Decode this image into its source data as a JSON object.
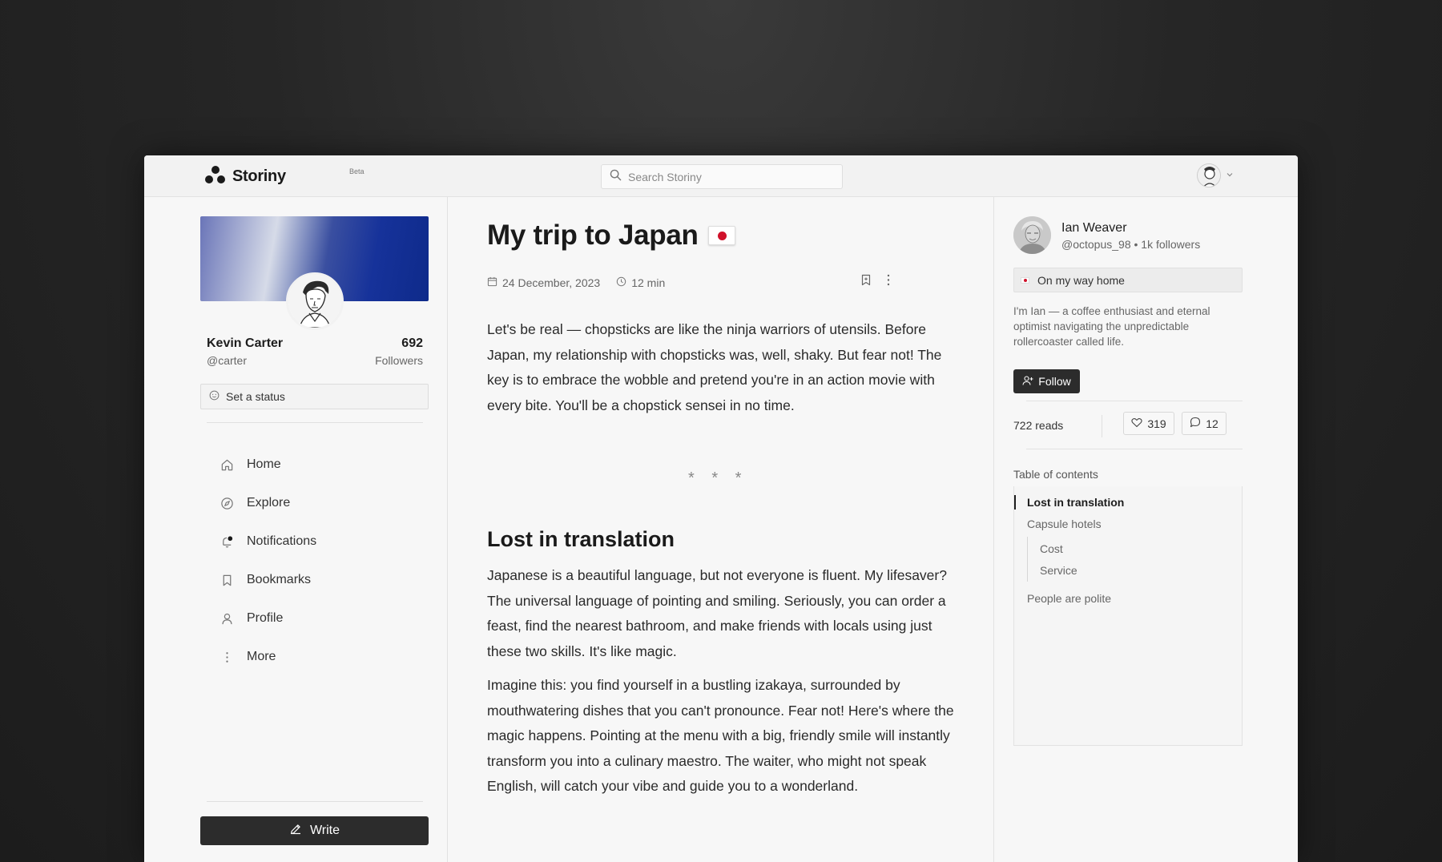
{
  "brand": {
    "name": "Storiny",
    "badge": "Beta"
  },
  "search": {
    "placeholder": "Search Storiny"
  },
  "profile": {
    "name": "Kevin Carter",
    "handle": "@carter",
    "followers_count": "692",
    "followers_label": "Followers",
    "status_placeholder": "Set a status"
  },
  "nav": {
    "home": "Home",
    "explore": "Explore",
    "notifications": "Notifications",
    "bookmarks": "Bookmarks",
    "profile": "Profile",
    "more": "More"
  },
  "write_label": "Write",
  "article": {
    "title": "My trip to Japan",
    "date": "24 December, 2023",
    "read_time": "12 min",
    "intro": "Let's be real — chopsticks are like the ninja warriors of utensils. Before Japan, my relationship with chopsticks was, well, shaky. But fear not! The key is to embrace the wobble and pretend you're in an action movie with every bite. You'll be a chopstick sensei in no time.",
    "separator": "* * *",
    "section_heading": "Lost in translation",
    "para1": "Japanese is a beautiful language, but not everyone is fluent. My lifesaver? The universal language of pointing and smiling. Seriously, you can order a feast, find the nearest bathroom, and make friends with locals using just these two skills. It's like magic.",
    "para2": "Imagine this: you find yourself in a bustling izakaya, surrounded by mouthwatering dishes that you can't pronounce. Fear not! Here's where the magic happens. Pointing at the menu with a big, friendly smile will instantly transform you into a culinary maestro. The waiter, who might not speak English, will catch your vibe and guide you to a wonderland."
  },
  "author": {
    "name": "Ian Weaver",
    "meta": "@octopus_98 • 1k followers",
    "status": "On my way home",
    "bio": "I'm Ian — a coffee enthusiast and eternal optimist navigating the unpredictable rollercoaster called life.",
    "follow_label": "Follow"
  },
  "stats": {
    "reads": "722 reads",
    "likes": "319",
    "comments": "12"
  },
  "toc": {
    "title": "Table of contents",
    "items": [
      "Lost in translation",
      "Capsule hotels",
      "Cost",
      "Service",
      "People are polite"
    ]
  }
}
